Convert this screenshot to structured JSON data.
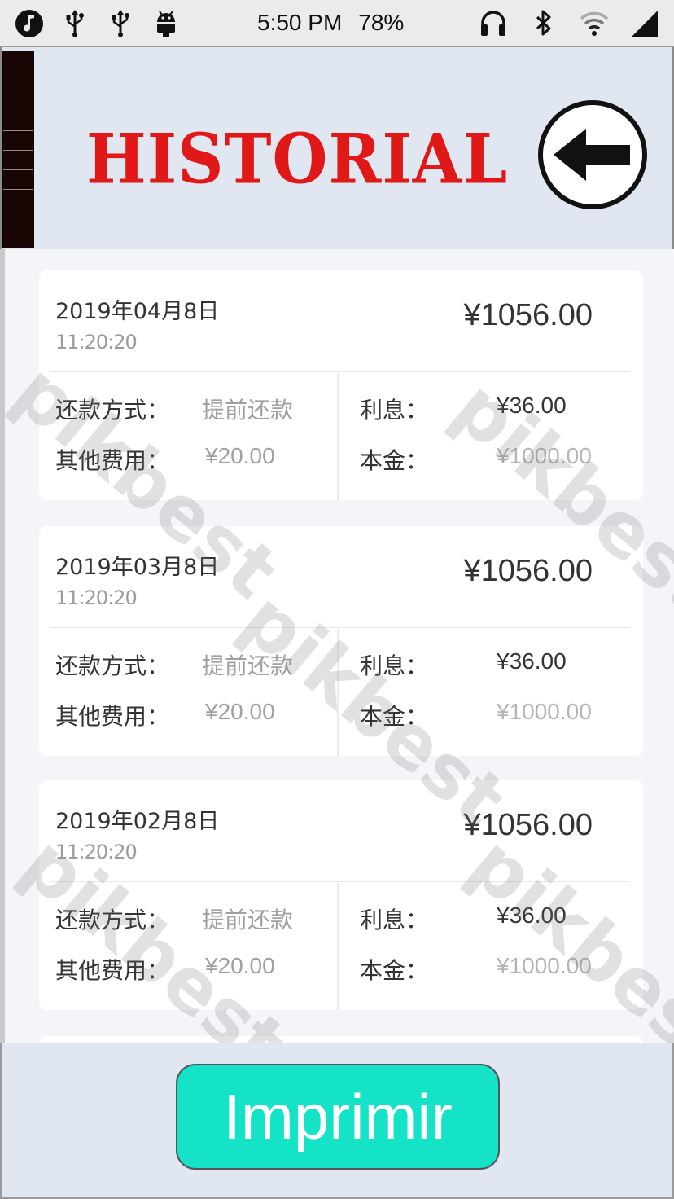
{
  "status_bar": {
    "time": "5:50 PM",
    "battery": "78%",
    "left_icons": [
      "music-note-icon",
      "usb-icon",
      "usb-icon",
      "android-icon"
    ],
    "right_icons": [
      "headphones-icon",
      "bluetooth-icon",
      "wifi-icon",
      "signal-icon"
    ]
  },
  "header": {
    "title": "HISTORIAL",
    "back_icon": "arrow-left-circle-icon",
    "title_color": "#e01818"
  },
  "labels": {
    "method": "还款方式：",
    "interest": "利息：",
    "other_fees": "其他费用：",
    "principal": "本金："
  },
  "records": [
    {
      "date": "2019年04月8日",
      "time": "11:20:20",
      "total": "¥1056.00",
      "method": "提前还款",
      "interest": "¥36.00",
      "other_fees": "¥20.00",
      "principal": "¥1000.00"
    },
    {
      "date": "2019年03月8日",
      "time": "11:20:20",
      "total": "¥1056.00",
      "method": "提前还款",
      "interest": "¥36.00",
      "other_fees": "¥20.00",
      "principal": "¥1000.00"
    },
    {
      "date": "2019年02月8日",
      "time": "11:20:20",
      "total": "¥1056.00",
      "method": "提前还款",
      "interest": "¥36.00",
      "other_fees": "¥20.00",
      "principal": "¥1000.00"
    }
  ],
  "watermark": "pikbest",
  "footer": {
    "print_label": "Imprimir",
    "print_color": "#14e3c8"
  }
}
